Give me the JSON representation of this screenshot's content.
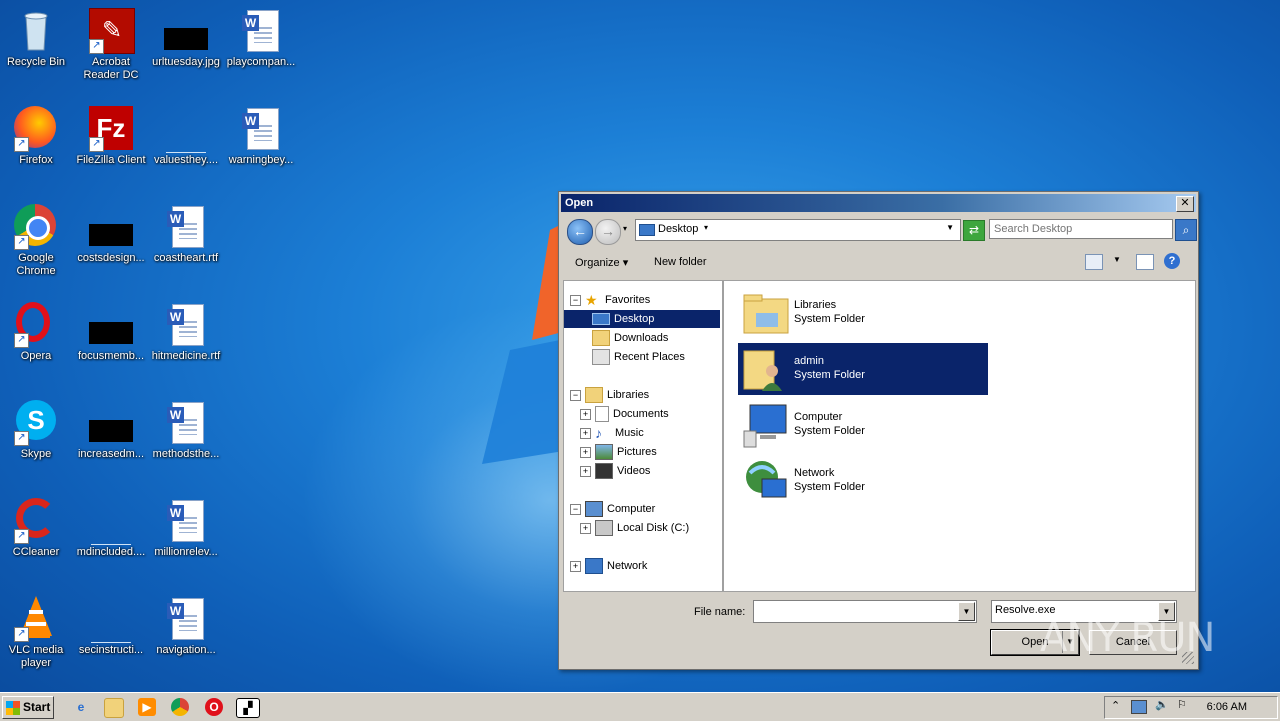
{
  "desktop": {
    "icons": [
      {
        "label": "Recycle Bin",
        "icon": "recycle-bin-icon"
      },
      {
        "label": "Acrobat Reader DC",
        "icon": "acrobat-icon"
      },
      {
        "label": "urltuesday.jpg",
        "icon": "image-file-icon"
      },
      {
        "label": "playcompan...",
        "icon": "word-doc-icon"
      },
      {
        "label": "Firefox",
        "icon": "firefox-icon"
      },
      {
        "label": "FileZilla Client",
        "icon": "filezilla-icon"
      },
      {
        "label": "valuesthey....",
        "icon": "file-icon"
      },
      {
        "label": "warningbey...",
        "icon": "word-doc-icon"
      },
      {
        "label": "Google Chrome",
        "icon": "chrome-icon"
      },
      {
        "label": "costsdesign...",
        "icon": "file-icon"
      },
      {
        "label": "coastheart.rtf",
        "icon": "word-doc-icon"
      },
      {
        "label": "Opera",
        "icon": "opera-icon"
      },
      {
        "label": "focusmemb...",
        "icon": "file-icon"
      },
      {
        "label": "hitmedicine.rtf",
        "icon": "word-doc-icon"
      },
      {
        "label": "Skype",
        "icon": "skype-icon"
      },
      {
        "label": "increasedm...",
        "icon": "file-icon"
      },
      {
        "label": "methodsthe...",
        "icon": "word-doc-icon"
      },
      {
        "label": "CCleaner",
        "icon": "ccleaner-icon"
      },
      {
        "label": "mdincluded....",
        "icon": "file-icon"
      },
      {
        "label": "millionrelev...",
        "icon": "word-doc-icon"
      },
      {
        "label": "VLC media player",
        "icon": "vlc-icon"
      },
      {
        "label": "secinstructi...",
        "icon": "file-icon"
      },
      {
        "label": "navigation...",
        "icon": "word-doc-icon"
      }
    ]
  },
  "dialog": {
    "title": "Open",
    "close_label": "✕",
    "address": "Desktop",
    "search_placeholder": "Search Desktop",
    "toolbar": {
      "organize": "Organize ▾",
      "new_folder": "New folder"
    },
    "tree": [
      {
        "label": "Favorites"
      },
      {
        "label": "Desktop"
      },
      {
        "label": "Downloads"
      },
      {
        "label": "Recent Places"
      },
      {
        "label": "Libraries"
      },
      {
        "label": "Documents"
      },
      {
        "label": "Music"
      },
      {
        "label": "Pictures"
      },
      {
        "label": "Videos"
      },
      {
        "label": "Computer"
      },
      {
        "label": "Local Disk (C:)"
      },
      {
        "label": "Network"
      }
    ],
    "items": [
      {
        "name": "Libraries",
        "type": "System Folder"
      },
      {
        "name": "admin",
        "type": "System Folder"
      },
      {
        "name": "Computer",
        "type": "System Folder"
      },
      {
        "name": "Network",
        "type": "System Folder"
      }
    ],
    "file_name_label": "File name:",
    "file_name_value": "",
    "file_type": "Resolve.exe",
    "open_label": "Open",
    "cancel_label": "Cancel"
  },
  "taskbar": {
    "start_label": "Start",
    "clock": "6:06 AM"
  },
  "watermark": "ANY RUN"
}
